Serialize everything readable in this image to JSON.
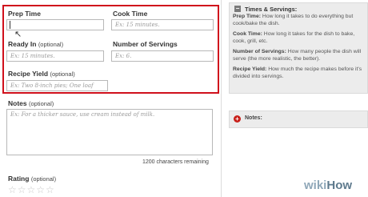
{
  "form": {
    "prep_time": {
      "label": "Prep Time",
      "placeholder": ""
    },
    "cook_time": {
      "label": "Cook Time",
      "placeholder": "Ex: 15 minutes."
    },
    "ready_in": {
      "label": "Ready In",
      "optional": "(optional)",
      "placeholder": "Ex: 15 minutes."
    },
    "servings": {
      "label": "Number of Servings",
      "placeholder": "Ex: 6."
    },
    "recipe_yield": {
      "label": "Recipe Yield",
      "optional": "(optional)",
      "placeholder": "Ex: Two 8-inch pies; One loaf"
    },
    "notes": {
      "label": "Notes",
      "optional": "(optional)",
      "placeholder": "Ex: For a thicker sauce, use cream instead of milk.",
      "remaining": "1200 characters remaining"
    },
    "rating": {
      "label": "Rating",
      "optional": "(optional)",
      "stars_display": "☆☆☆☆☆"
    }
  },
  "sidebar": {
    "title": "Times & Servings:",
    "toggle_minus": "−",
    "items": [
      {
        "term": "Prep Time:",
        "text": "How long it takes to do everything but cook/bake the dish."
      },
      {
        "term": "Cook Time:",
        "text": "How long it takes for the dish to bake, cook, grill, etc."
      },
      {
        "term": "Number of Servings:",
        "text": "How many people the dish will serve (the more realistic, the better)."
      },
      {
        "term": "Recipe Yield:",
        "text": "How much the recipe makes before it's divided into servings."
      }
    ],
    "notes_label": "Notes:",
    "toggle_plus": "+"
  },
  "watermark": {
    "wiki": "wiki",
    "how": "How"
  },
  "colors": {
    "highlight": "#d0101c",
    "sidebar_bg": "#ececec",
    "plus_icon": "#c8201a"
  }
}
